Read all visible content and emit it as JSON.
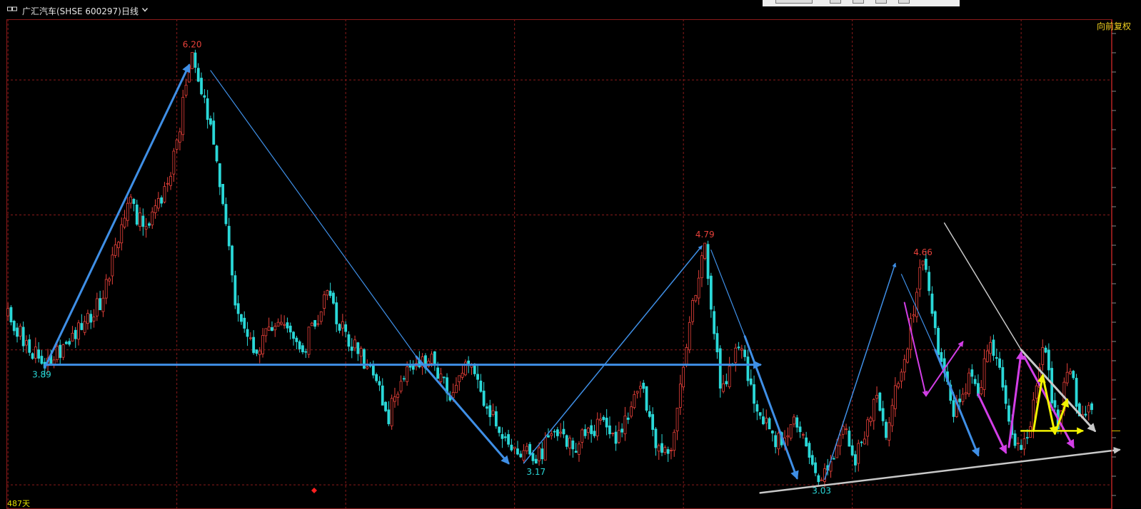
{
  "header": {
    "stock_label": "广汇汽车(SHSE 600297)",
    "period_label": "日线"
  },
  "adjust_label": "向前复权",
  "days_label": "487天",
  "colors": {
    "up": "#e8413a",
    "down": "#2ad8d8",
    "wave": "#3f8fe6",
    "magenta": "#d23ee6",
    "yellow": "#f2f200",
    "gray": "#c8c8c8",
    "grid": "#8a1a1a"
  },
  "chart_data": {
    "type": "candlestick",
    "ylim": [
      2.9,
      6.45
    ],
    "annotations": [
      {
        "text": "6.20",
        "price": 6.2,
        "day": 60,
        "kind": "high"
      },
      {
        "text": "3.89",
        "price": 3.89,
        "day": 11,
        "kind": "low"
      },
      {
        "text": "3.17",
        "price": 3.17,
        "day": 172,
        "kind": "low"
      },
      {
        "text": "4.79",
        "price": 4.79,
        "day": 227,
        "kind": "high"
      },
      {
        "text": "3.03",
        "price": 3.03,
        "day": 265,
        "kind": "low"
      },
      {
        "text": "4.66",
        "price": 4.66,
        "day": 298,
        "kind": "high"
      }
    ],
    "pivots": [
      [
        0,
        4.25
      ],
      [
        11,
        3.89
      ],
      [
        19,
        4.05
      ],
      [
        30,
        4.35
      ],
      [
        40,
        5.1
      ],
      [
        45,
        4.85
      ],
      [
        53,
        5.3
      ],
      [
        60,
        6.2
      ],
      [
        68,
        5.45
      ],
      [
        74,
        4.4
      ],
      [
        80,
        4.0
      ],
      [
        88,
        4.2
      ],
      [
        96,
        4.0
      ],
      [
        104,
        4.4
      ],
      [
        110,
        4.1
      ],
      [
        118,
        3.85
      ],
      [
        124,
        3.5
      ],
      [
        128,
        3.8
      ],
      [
        138,
        3.95
      ],
      [
        144,
        3.65
      ],
      [
        150,
        3.9
      ],
      [
        160,
        3.4
      ],
      [
        172,
        3.17
      ],
      [
        178,
        3.4
      ],
      [
        185,
        3.3
      ],
      [
        192,
        3.45
      ],
      [
        198,
        3.35
      ],
      [
        206,
        3.75
      ],
      [
        212,
        3.25
      ],
      [
        216,
        3.3
      ],
      [
        222,
        4.2
      ],
      [
        227,
        4.79
      ],
      [
        232,
        3.7
      ],
      [
        238,
        4.05
      ],
      [
        244,
        3.55
      ],
      [
        250,
        3.3
      ],
      [
        256,
        3.45
      ],
      [
        265,
        3.03
      ],
      [
        272,
        3.4
      ],
      [
        276,
        3.2
      ],
      [
        283,
        3.65
      ],
      [
        286,
        3.4
      ],
      [
        292,
        3.95
      ],
      [
        298,
        4.66
      ],
      [
        303,
        4.0
      ],
      [
        308,
        3.55
      ],
      [
        313,
        3.8
      ],
      [
        316,
        3.65
      ],
      [
        320,
        4.1
      ],
      [
        324,
        3.7
      ],
      [
        328,
        3.25
      ],
      [
        332,
        3.3
      ],
      [
        337,
        4.05
      ],
      [
        342,
        3.4
      ],
      [
        345,
        3.9
      ],
      [
        349,
        3.55
      ],
      [
        353,
        3.55
      ]
    ],
    "drawings": [
      {
        "color": "wave",
        "width": 3,
        "arrow": true,
        "points": [
          [
            12,
            3.87
          ],
          [
            59,
            6.11
          ]
        ]
      },
      {
        "color": "wave",
        "width": 1.2,
        "arrow": false,
        "points": [
          [
            66,
            6.07
          ],
          [
            133,
            3.95
          ]
        ]
      },
      {
        "color": "wave",
        "width": 3,
        "arrow": true,
        "points": [
          [
            133,
            3.95
          ],
          [
            163,
            3.16
          ]
        ]
      },
      {
        "color": "wave",
        "width": 3,
        "arrow": true,
        "points": [
          [
            12,
            3.89
          ],
          [
            245,
            3.89
          ]
        ]
      },
      {
        "color": "wave",
        "width": 1.5,
        "arrow": true,
        "points": [
          [
            168,
            3.16
          ],
          [
            226,
            4.77
          ]
        ]
      },
      {
        "color": "wave",
        "width": 1.2,
        "arrow": false,
        "points": [
          [
            229,
            4.74
          ],
          [
            240,
            4.1
          ]
        ]
      },
      {
        "color": "wave",
        "width": 3,
        "arrow": true,
        "points": [
          [
            240,
            4.1
          ],
          [
            257,
            3.05
          ]
        ]
      },
      {
        "color": "wave",
        "width": 1.5,
        "arrow": true,
        "points": [
          [
            266,
            3.04
          ],
          [
            289,
            4.64
          ]
        ]
      },
      {
        "color": "wave",
        "width": 1.2,
        "arrow": false,
        "points": [
          [
            291,
            4.56
          ],
          [
            302,
            4.0
          ]
        ]
      },
      {
        "color": "wave",
        "width": 3,
        "arrow": true,
        "points": [
          [
            302,
            4.0
          ],
          [
            316,
            3.22
          ]
        ]
      },
      {
        "color": "gray",
        "width": 2.5,
        "arrow": true,
        "points": [
          [
            245,
            2.94
          ],
          [
            362,
            3.26
          ]
        ]
      },
      {
        "color": "gray",
        "width": 1.5,
        "arrow": false,
        "points": [
          [
            305,
            4.94
          ],
          [
            330,
            4.0
          ]
        ]
      },
      {
        "color": "gray",
        "width": 3,
        "arrow": true,
        "points": [
          [
            330,
            4.0
          ],
          [
            354,
            3.4
          ]
        ]
      },
      {
        "color": "magenta",
        "width": 2,
        "arrow": true,
        "points": [
          [
            292,
            4.35
          ],
          [
            299,
            3.66
          ]
        ]
      },
      {
        "color": "magenta",
        "width": 2,
        "arrow": true,
        "points": [
          [
            299,
            3.66
          ],
          [
            311,
            4.06
          ]
        ]
      },
      {
        "color": "magenta",
        "width": 3,
        "arrow": true,
        "points": [
          [
            316,
            3.67
          ],
          [
            325,
            3.24
          ]
        ]
      },
      {
        "color": "magenta",
        "width": 3,
        "arrow": true,
        "points": [
          [
            326,
            3.28
          ],
          [
            330,
            3.98
          ]
        ]
      },
      {
        "color": "magenta",
        "width": 3,
        "arrow": true,
        "points": [
          [
            331,
            3.95
          ],
          [
            347,
            3.28
          ]
        ]
      },
      {
        "color": "yellow",
        "width": 3,
        "arrow": true,
        "points": [
          [
            334,
            3.4
          ],
          [
            337,
            3.81
          ]
        ]
      },
      {
        "color": "yellow",
        "width": 3,
        "arrow": true,
        "points": [
          [
            337,
            3.81
          ],
          [
            341,
            3.38
          ]
        ]
      },
      {
        "color": "yellow",
        "width": 3,
        "arrow": true,
        "points": [
          [
            341,
            3.38
          ],
          [
            345,
            3.63
          ]
        ]
      },
      {
        "color": "yellow",
        "width": 2.5,
        "arrow": true,
        "points": [
          [
            330,
            3.4
          ],
          [
            350,
            3.4
          ]
        ]
      }
    ]
  }
}
